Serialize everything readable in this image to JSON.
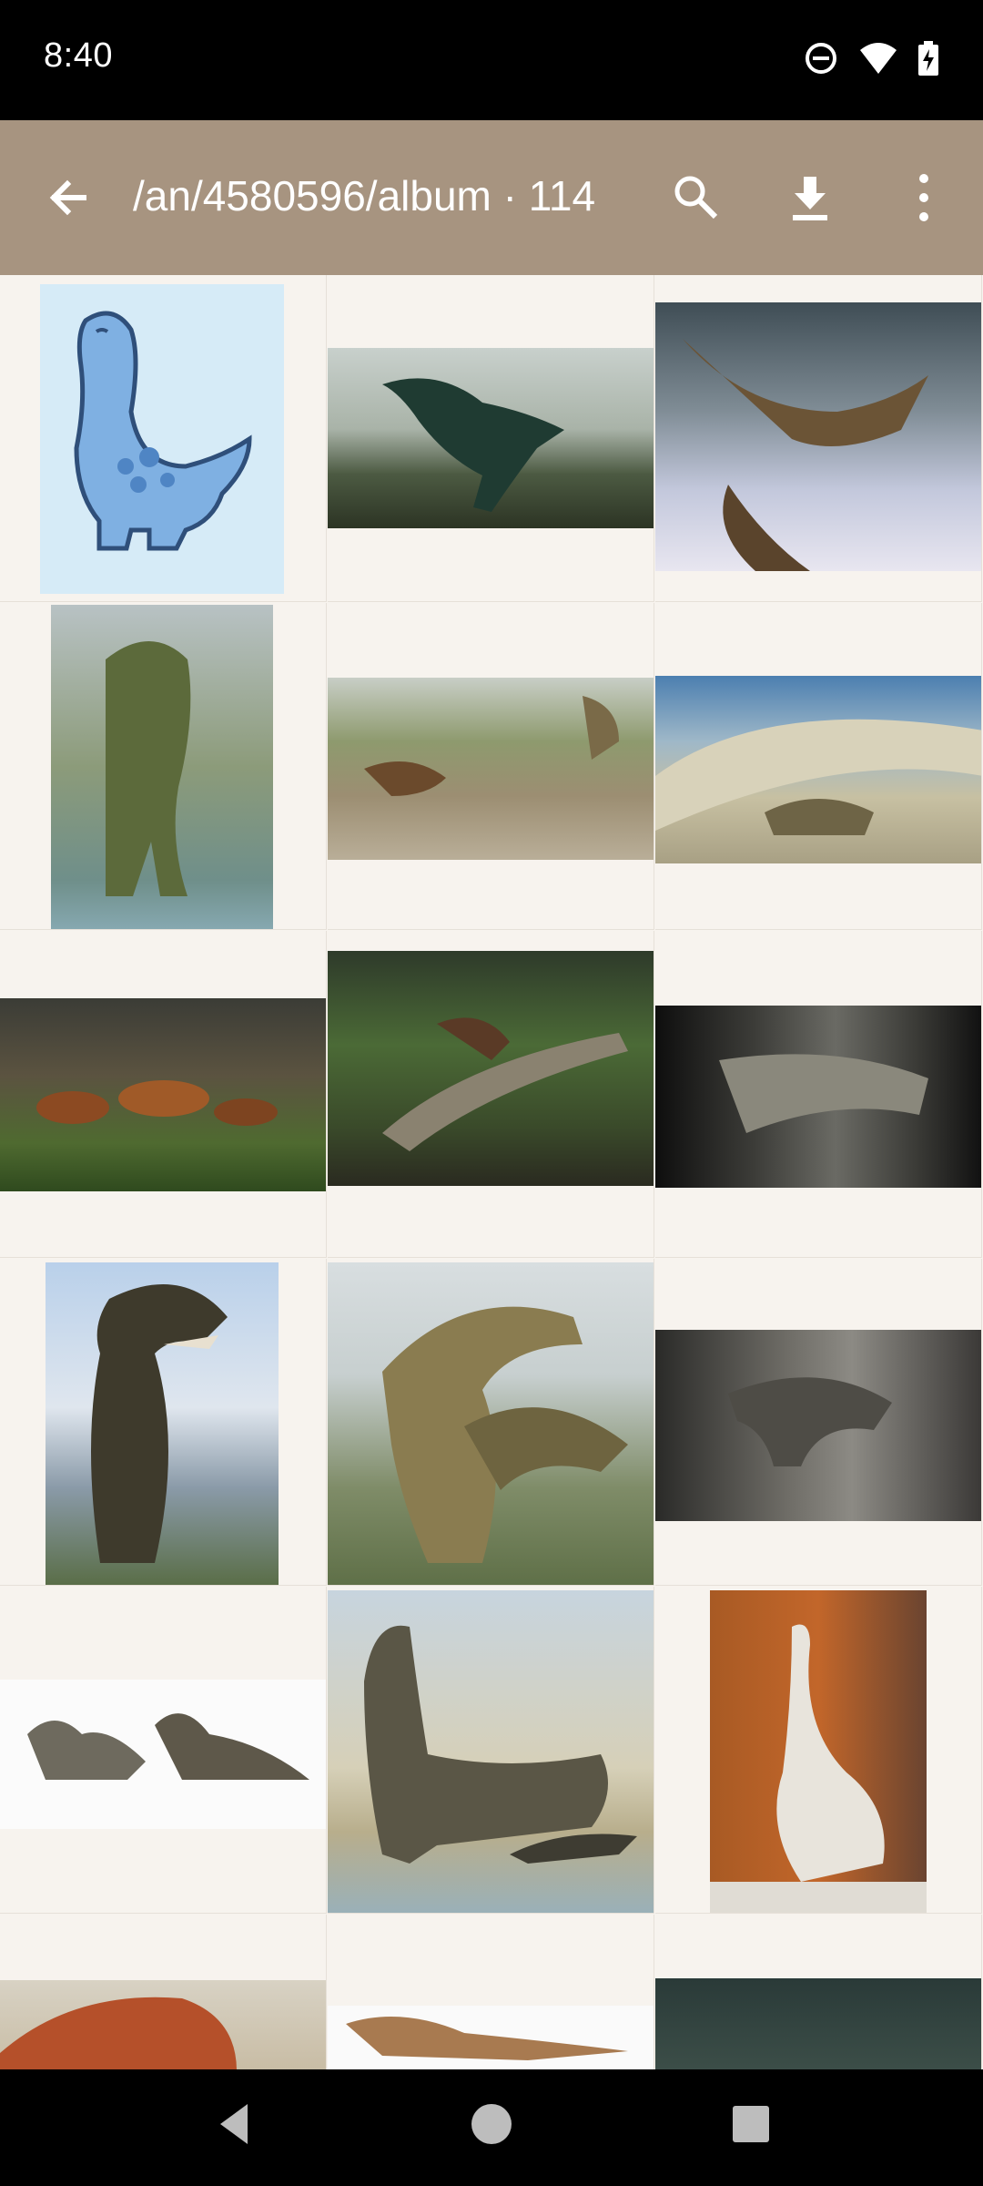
{
  "status_bar": {
    "time": "8:40",
    "icons": [
      "do-not-disturb-icon",
      "wifi-icon",
      "battery-charging-icon"
    ]
  },
  "app_bar": {
    "title": "/an/4580596/album · 114",
    "background": "#a79480",
    "actions": [
      "back-arrow-icon",
      "search-icon",
      "download-icon",
      "more-vert-icon"
    ]
  },
  "album": {
    "item_count": 114,
    "thumbnails": [
      {
        "subject": "cartoon-blue-dinosaur"
      },
      {
        "subject": "feathered-dinosaur-green"
      },
      {
        "subject": "feathered-dinosaur-leaping"
      },
      {
        "subject": "spinosaurus-standing"
      },
      {
        "subject": "dinosaurs-marsh"
      },
      {
        "subject": "dinosaur-in-fallen-logs"
      },
      {
        "subject": "small-dinosaurs-forest"
      },
      {
        "subject": "dinosaurs-jungle"
      },
      {
        "subject": "dark-dinosaur-scene"
      },
      {
        "subject": "tyrannosaurus-portrait"
      },
      {
        "subject": "allosaurus-pair"
      },
      {
        "subject": "dinosaur-museum-indoor"
      },
      {
        "subject": "sauropods-white-background"
      },
      {
        "subject": "sauropod-by-lake"
      },
      {
        "subject": "feathered-dinosaur-orange-wall"
      },
      {
        "subject": "armored-dinosaur"
      },
      {
        "subject": "carnotaurus-white"
      },
      {
        "subject": "dark-forest-dinosaur"
      }
    ]
  }
}
